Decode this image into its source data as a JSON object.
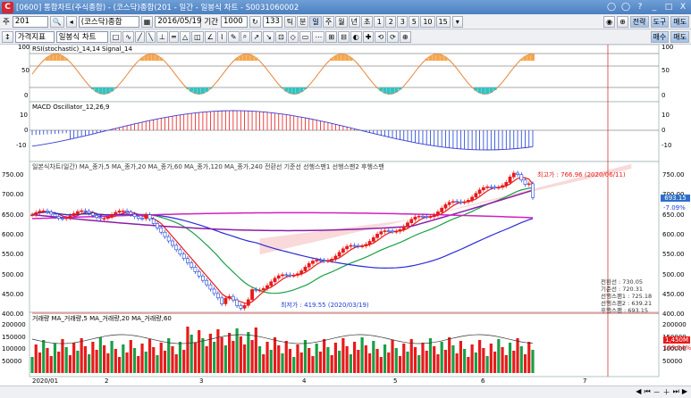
{
  "window": {
    "title": "[0600] 통합차트(주식종합) - (코스닥)종합(201 - 일간 - 일봉식 차트 - S0031060002",
    "controls": [
      "◯",
      "◯",
      "?",
      "_",
      "□",
      "X"
    ]
  },
  "toolbar1": {
    "market_label": "주",
    "code": "201",
    "name": "(코스닥)종합",
    "date": "2016/05/19",
    "period_label": "기간",
    "period_value": "1000",
    "count": "133",
    "interval_buttons": [
      "틱",
      "분",
      "일",
      "주",
      "월",
      "년",
      "초",
      "1",
      "2",
      "3",
      "5",
      "10",
      "15"
    ],
    "right_buttons": [
      "전략",
      "도구",
      "매도"
    ]
  },
  "toolbar2": {
    "type_label": "가격지표",
    "chart_label": "일봉식 차트",
    "right_buttons": [
      "매수",
      "매도"
    ]
  },
  "panels": {
    "rsi": {
      "title": "RSI(stochastic)_14,14  Signal_14",
      "axis": [
        "100",
        "50",
        "0"
      ]
    },
    "macd": {
      "title": "MACD Oscillator_12,26,9",
      "axis": [
        "10",
        "0",
        "-10"
      ]
    },
    "price": {
      "title": "일본식차트(일간) MA_종가,5  MA_종가,20  MA_종가,60  MA_종가,120  MA_종가,240  전환선  기준선  선행스팬1  선행스팬2  후행스팬",
      "axis": [
        "750.00",
        "700.00",
        "650.00",
        "600.00",
        "550.00",
        "500.00",
        "450.00",
        "400.00"
      ],
      "high_label": "최고가 : 766.96 (2020/06/11)",
      "low_label": "최저가 : 419.55 (2020/03/19)",
      "current_price": "693.15",
      "change_pct": "-7.09%",
      "info": [
        "전환선   : 730.05",
        "기준선   : 720.31",
        "선행스팬1 : 725.18",
        "선행스팬2 : 639.21",
        "후행스팬  : 693.15"
      ]
    },
    "volume": {
      "title": "거래량  MA_거래량,5  MA_거래량,20  MA_거래량,60",
      "axis": [
        "200000",
        "150000",
        "100000",
        "50000"
      ],
      "last_volume": "1,450M",
      "vol_pct": "109.54%"
    }
  },
  "xaxis": [
    "2020/01",
    "2",
    "3",
    "4",
    "5",
    "6",
    "7"
  ],
  "colors": {
    "up": "#e81a1a",
    "down": "#1a3fd6",
    "ma5": "#e81a1a",
    "ma20": "#18a046",
    "ma60": "#2b2bd8",
    "ma120": "#8b1ea8",
    "ma240": "#8a8a8a",
    "cloud": "#f6c8c8"
  }
}
